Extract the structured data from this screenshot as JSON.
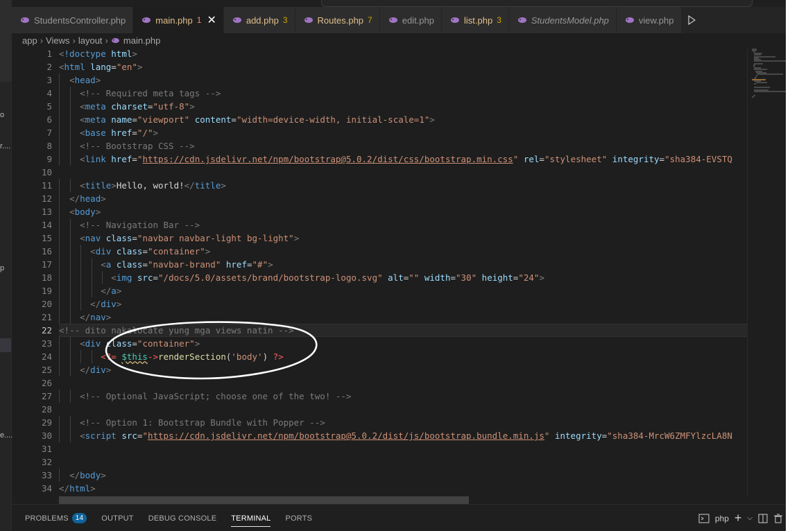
{
  "tabs": [
    {
      "label": "StudentsController.php",
      "badge": "",
      "state": "normal",
      "italic": false
    },
    {
      "label": "main.php",
      "badge": "1",
      "state": "active",
      "italic": false
    },
    {
      "label": "add.php",
      "badge": "3",
      "state": "warn",
      "italic": false
    },
    {
      "label": "Routes.php",
      "badge": "7",
      "state": "warn",
      "italic": false
    },
    {
      "label": "edit.php",
      "badge": "",
      "state": "normal",
      "italic": false
    },
    {
      "label": "list.php",
      "badge": "3",
      "state": "warn",
      "italic": false
    },
    {
      "label": "StudentsModel.php",
      "badge": "",
      "state": "normal",
      "italic": true
    },
    {
      "label": "view.php",
      "badge": "",
      "state": "normal",
      "italic": false
    }
  ],
  "breadcrumb": [
    "app",
    "Views",
    "layout",
    "main.php"
  ],
  "sidebar_fragments": [
    "o",
    "r....",
    "p",
    "e...."
  ],
  "current_line": 22,
  "lines": [
    {
      "n": "1",
      "indent": 0,
      "tokens": [
        [
          "ang",
          "<"
        ],
        [
          "tg",
          "!doctype"
        ],
        [
          "txt",
          " "
        ],
        [
          "at",
          "html"
        ],
        [
          "ang",
          ">"
        ]
      ]
    },
    {
      "n": "2",
      "indent": 0,
      "tokens": [
        [
          "ang",
          "<"
        ],
        [
          "tg",
          "html"
        ],
        [
          "txt",
          " "
        ],
        [
          "at",
          "lang"
        ],
        [
          "txt",
          "="
        ],
        [
          "st",
          "\"en\""
        ],
        [
          "ang",
          ">"
        ]
      ]
    },
    {
      "n": "3",
      "indent": 1,
      "tokens": [
        [
          "ang",
          "<"
        ],
        [
          "tg",
          "head"
        ],
        [
          "ang",
          ">"
        ]
      ]
    },
    {
      "n": "4",
      "indent": 2,
      "tokens": [
        [
          "cmgray",
          "<!-- Required meta tags -->"
        ]
      ]
    },
    {
      "n": "5",
      "indent": 2,
      "tokens": [
        [
          "ang",
          "<"
        ],
        [
          "tg",
          "meta"
        ],
        [
          "txt",
          " "
        ],
        [
          "at",
          "charset"
        ],
        [
          "txt",
          "="
        ],
        [
          "st",
          "\"utf-8\""
        ],
        [
          "ang",
          ">"
        ]
      ]
    },
    {
      "n": "6",
      "indent": 2,
      "tokens": [
        [
          "ang",
          "<"
        ],
        [
          "tg",
          "meta"
        ],
        [
          "txt",
          " "
        ],
        [
          "at",
          "name"
        ],
        [
          "txt",
          "="
        ],
        [
          "st",
          "\"viewport\""
        ],
        [
          "txt",
          " "
        ],
        [
          "at",
          "content"
        ],
        [
          "txt",
          "="
        ],
        [
          "st",
          "\"width=device-width, initial-scale=1\""
        ],
        [
          "ang",
          ">"
        ]
      ]
    },
    {
      "n": "7",
      "indent": 2,
      "tokens": [
        [
          "ang",
          "<"
        ],
        [
          "tg",
          "base"
        ],
        [
          "txt",
          " "
        ],
        [
          "at",
          "href"
        ],
        [
          "txt",
          "="
        ],
        [
          "st",
          "\"/\""
        ],
        [
          "ang",
          ">"
        ]
      ]
    },
    {
      "n": "8",
      "indent": 2,
      "tokens": [
        [
          "cmgray",
          "<!-- Bootstrap CSS -->"
        ]
      ]
    },
    {
      "n": "9",
      "indent": 2,
      "tokens": [
        [
          "ang",
          "<"
        ],
        [
          "tg",
          "link"
        ],
        [
          "txt",
          " "
        ],
        [
          "at",
          "href"
        ],
        [
          "txt",
          "="
        ],
        [
          "st",
          "\""
        ],
        [
          "url",
          "https://cdn.jsdelivr.net/npm/bootstrap@5.0.2/dist/css/bootstrap.min.css"
        ],
        [
          "st",
          "\""
        ],
        [
          "txt",
          " "
        ],
        [
          "at",
          "rel"
        ],
        [
          "txt",
          "="
        ],
        [
          "st",
          "\"stylesheet\""
        ],
        [
          "txt",
          " "
        ],
        [
          "at",
          "integrity"
        ],
        [
          "txt",
          "="
        ],
        [
          "st",
          "\"sha384-EVSTQ"
        ]
      ]
    },
    {
      "n": "10",
      "indent": 0,
      "tokens": []
    },
    {
      "n": "11",
      "indent": 2,
      "tokens": [
        [
          "ang",
          "<"
        ],
        [
          "tg",
          "title"
        ],
        [
          "ang",
          ">"
        ],
        [
          "txt",
          "Hello, world!"
        ],
        [
          "ang",
          "</"
        ],
        [
          "tg",
          "title"
        ],
        [
          "ang",
          ">"
        ]
      ]
    },
    {
      "n": "12",
      "indent": 1,
      "tokens": [
        [
          "ang",
          "</"
        ],
        [
          "tg",
          "head"
        ],
        [
          "ang",
          ">"
        ]
      ]
    },
    {
      "n": "13",
      "indent": 1,
      "tokens": [
        [
          "ang",
          "<"
        ],
        [
          "tg",
          "body"
        ],
        [
          "ang",
          ">"
        ]
      ]
    },
    {
      "n": "14",
      "indent": 2,
      "tokens": [
        [
          "cmgray",
          "<!-- Navigation Bar -->"
        ]
      ]
    },
    {
      "n": "15",
      "indent": 2,
      "tokens": [
        [
          "ang",
          "<"
        ],
        [
          "tg",
          "nav"
        ],
        [
          "txt",
          " "
        ],
        [
          "at",
          "class"
        ],
        [
          "txt",
          "="
        ],
        [
          "st",
          "\"navbar navbar-light bg-light\""
        ],
        [
          "ang",
          ">"
        ]
      ]
    },
    {
      "n": "16",
      "indent": 3,
      "tokens": [
        [
          "ang",
          "<"
        ],
        [
          "tg",
          "div"
        ],
        [
          "txt",
          " "
        ],
        [
          "at",
          "class"
        ],
        [
          "txt",
          "="
        ],
        [
          "st",
          "\"container\""
        ],
        [
          "ang",
          ">"
        ]
      ]
    },
    {
      "n": "17",
      "indent": 4,
      "tokens": [
        [
          "ang",
          "<"
        ],
        [
          "tg",
          "a"
        ],
        [
          "txt",
          " "
        ],
        [
          "at",
          "class"
        ],
        [
          "txt",
          "="
        ],
        [
          "st",
          "\"navbar-brand\""
        ],
        [
          "txt",
          " "
        ],
        [
          "at",
          "href"
        ],
        [
          "txt",
          "="
        ],
        [
          "st",
          "\"#\""
        ],
        [
          "ang",
          ">"
        ]
      ]
    },
    {
      "n": "18",
      "indent": 5,
      "tokens": [
        [
          "ang",
          "<"
        ],
        [
          "tg",
          "img"
        ],
        [
          "txt",
          " "
        ],
        [
          "at",
          "src"
        ],
        [
          "txt",
          "="
        ],
        [
          "st",
          "\"/docs/5.0/assets/brand/bootstrap-logo.svg\""
        ],
        [
          "txt",
          " "
        ],
        [
          "at",
          "alt"
        ],
        [
          "txt",
          "="
        ],
        [
          "st",
          "\"\""
        ],
        [
          "txt",
          " "
        ],
        [
          "at",
          "width"
        ],
        [
          "txt",
          "="
        ],
        [
          "st",
          "\"30\""
        ],
        [
          "txt",
          " "
        ],
        [
          "at",
          "height"
        ],
        [
          "txt",
          "="
        ],
        [
          "st",
          "\"24\""
        ],
        [
          "ang",
          ">"
        ]
      ]
    },
    {
      "n": "19",
      "indent": 4,
      "tokens": [
        [
          "ang",
          "</"
        ],
        [
          "tg",
          "a"
        ],
        [
          "ang",
          ">"
        ]
      ]
    },
    {
      "n": "20",
      "indent": 3,
      "tokens": [
        [
          "ang",
          "</"
        ],
        [
          "tg",
          "div"
        ],
        [
          "ang",
          ">"
        ]
      ]
    },
    {
      "n": "21",
      "indent": 2,
      "tokens": [
        [
          "ang",
          "</"
        ],
        [
          "tg",
          "nav"
        ],
        [
          "ang",
          ">"
        ]
      ]
    },
    {
      "n": "22",
      "indent": 0,
      "tokens": [
        [
          "cmgray",
          "<!-- dito nakalocate yung mga views natin -->"
        ]
      ]
    },
    {
      "n": "23",
      "indent": 2,
      "tokens": [
        [
          "ang",
          "<"
        ],
        [
          "tg",
          "div"
        ],
        [
          "txt",
          " "
        ],
        [
          "at",
          "class"
        ],
        [
          "txt",
          "="
        ],
        [
          "st",
          "\"container\""
        ],
        [
          "ang",
          ">"
        ]
      ]
    },
    {
      "n": "24",
      "indent": 4,
      "tokens": [
        [
          "php",
          "<?="
        ],
        [
          "txt",
          " "
        ],
        [
          "var",
          "$this"
        ],
        [
          "php",
          "->"
        ],
        [
          "fn",
          "renderSection"
        ],
        [
          "txt",
          "("
        ],
        [
          "st",
          "'body'"
        ],
        [
          "txt",
          ") "
        ],
        [
          "php",
          "?>"
        ]
      ]
    },
    {
      "n": "25",
      "indent": 2,
      "tokens": [
        [
          "ang",
          "</"
        ],
        [
          "tg",
          "div"
        ],
        [
          "ang",
          ">"
        ]
      ]
    },
    {
      "n": "26",
      "indent": 0,
      "tokens": []
    },
    {
      "n": "27",
      "indent": 2,
      "tokens": [
        [
          "cmgray",
          "<!-- Optional JavaScript; choose one of the two! -->"
        ]
      ]
    },
    {
      "n": "28",
      "indent": 0,
      "tokens": []
    },
    {
      "n": "29",
      "indent": 2,
      "tokens": [
        [
          "cmgray",
          "<!-- Option 1: Bootstrap Bundle with Popper -->"
        ]
      ]
    },
    {
      "n": "30",
      "indent": 2,
      "tokens": [
        [
          "ang",
          "<"
        ],
        [
          "tg",
          "script"
        ],
        [
          "txt",
          " "
        ],
        [
          "at",
          "src"
        ],
        [
          "txt",
          "="
        ],
        [
          "st",
          "\""
        ],
        [
          "url",
          "https://cdn.jsdelivr.net/npm/bootstrap@5.0.2/dist/js/bootstrap.bundle.min.js"
        ],
        [
          "st",
          "\""
        ],
        [
          "txt",
          " "
        ],
        [
          "at",
          "integrity"
        ],
        [
          "txt",
          "="
        ],
        [
          "st",
          "\"sha384-MrcW6ZMFYlzcLA8N"
        ]
      ]
    },
    {
      "n": "31",
      "indent": 0,
      "tokens": []
    },
    {
      "n": "32",
      "indent": 0,
      "tokens": []
    },
    {
      "n": "33",
      "indent": 1,
      "tokens": [
        [
          "ang",
          "</"
        ],
        [
          "tg",
          "body"
        ],
        [
          "ang",
          ">"
        ]
      ]
    },
    {
      "n": "34",
      "indent": 0,
      "tokens": [
        [
          "ang",
          "</"
        ],
        [
          "tg",
          "html"
        ],
        [
          "ang",
          ">"
        ]
      ]
    }
  ],
  "panel": {
    "tabs": [
      {
        "label": "PROBLEMS",
        "badge": "14",
        "active": false
      },
      {
        "label": "OUTPUT",
        "badge": "",
        "active": false
      },
      {
        "label": "DEBUG CONSOLE",
        "badge": "",
        "active": false
      },
      {
        "label": "TERMINAL",
        "badge": "",
        "active": true
      },
      {
        "label": "PORTS",
        "badge": "",
        "active": false
      }
    ],
    "terminal_name": "php",
    "plus": "+",
    "chevron": "⌵"
  },
  "colors": {
    "editor_bg": "#1e1e1e",
    "tab_active_fg": "#e2c08d",
    "php_icon": "#a074c4",
    "annotation_circle": "#ffffff"
  },
  "icons": {
    "file": "php-elephant-icon",
    "close": "close-icon",
    "run": "run-icon",
    "split": "split-editor-icon",
    "trash": "trash-icon",
    "terminal": "terminal-icon"
  }
}
